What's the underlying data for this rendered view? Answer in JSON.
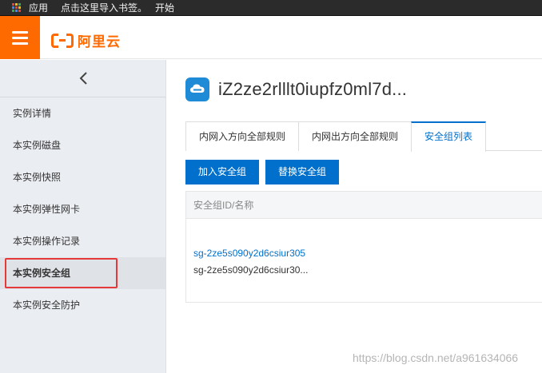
{
  "browser": {
    "bookmarks": {
      "apps_label": "应用",
      "hint": "点击这里导入书签。",
      "start_label": "开始"
    }
  },
  "header": {
    "logo_text": "阿里云"
  },
  "sidebar": {
    "items": [
      {
        "label": "实例详情"
      },
      {
        "label": "本实例磁盘"
      },
      {
        "label": "本实例快照"
      },
      {
        "label": "本实例弹性网卡"
      },
      {
        "label": "本实例操作记录"
      },
      {
        "label": "本实例安全组",
        "active": true
      },
      {
        "label": "本实例安全防护"
      }
    ]
  },
  "main": {
    "instance_title": "iZ2ze2rlllt0iupfz0ml7d...",
    "tabs": [
      {
        "label": "内网入方向全部规则"
      },
      {
        "label": "内网出方向全部规则"
      },
      {
        "label": "安全组列表",
        "active": true
      }
    ],
    "buttons": {
      "add_label": "加入安全组",
      "replace_label": "替换安全组"
    },
    "table": {
      "header": "安全组ID/名称",
      "rows": [
        {
          "id": "sg-2ze5s090y2d6csiur305",
          "name": "sg-2ze5s090y2d6csiur30..."
        }
      ]
    }
  },
  "watermark": "https://blog.csdn.net/a961634066",
  "colors": {
    "brand": "#ff6a00",
    "primary": "#0070cc",
    "highlight_box": "#e5393a"
  }
}
